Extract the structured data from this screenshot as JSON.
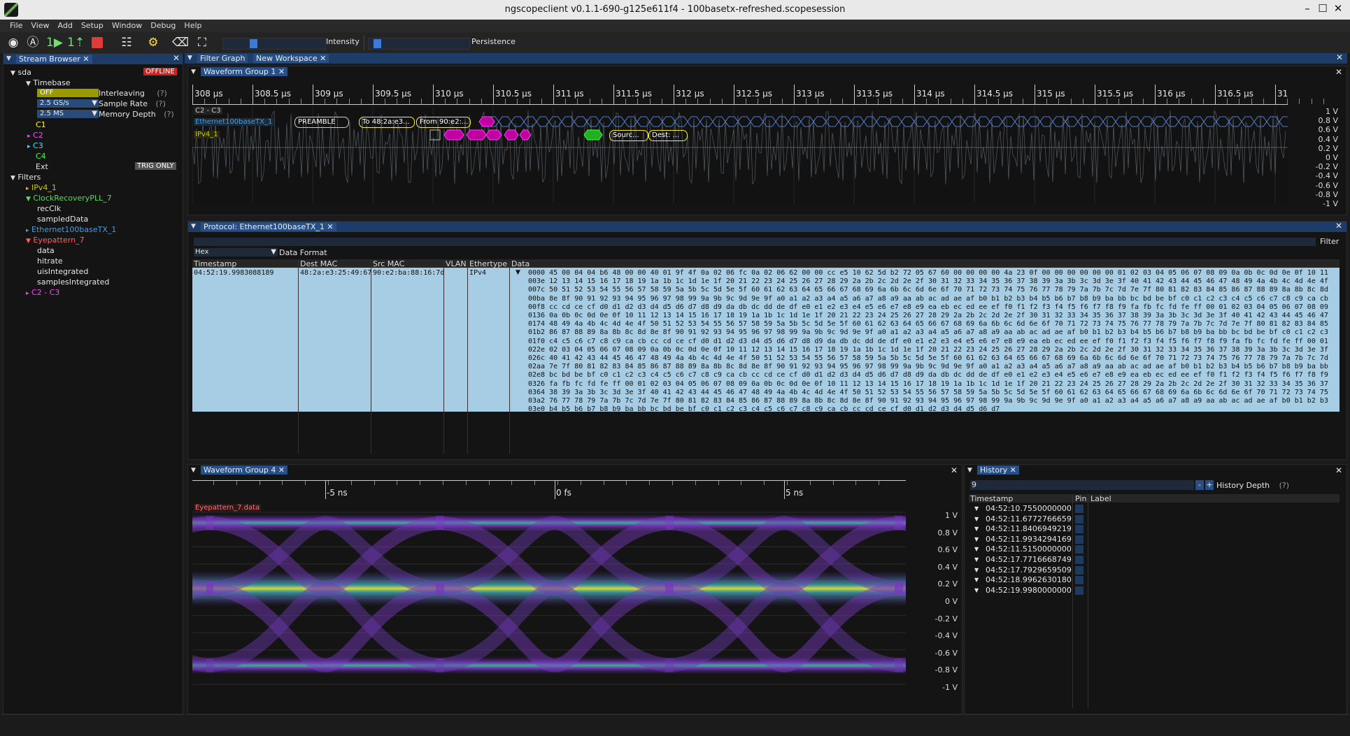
{
  "window": {
    "title": "ngscopeclient v0.1.1-690-g125e611f4 - 100basetx-refreshed.scopesession"
  },
  "menu": [
    "File",
    "View",
    "Add",
    "Setup",
    "Window",
    "Debug",
    "Help"
  ],
  "toolbar": {
    "intensity_label": "Intensity",
    "persistence_label": "Persistence",
    "intensity_level": 0.28,
    "persistence_level": 0.05
  },
  "stream_browser": {
    "tab_label": "Stream Browser",
    "instrument": "sda",
    "status": "OFFLINE",
    "timebase_label": "Timebase",
    "interleaving_value": "OFF",
    "interleaving_label": "Interleaving",
    "sample_rate_value": "2.5 GS/s",
    "sample_rate_label": "Sample Rate",
    "memory_depth_value": "2.5 MS",
    "memory_depth_label": "Memory Depth",
    "help": "(?)",
    "channels": [
      "C1",
      "C2",
      "C3",
      "C4",
      "Ext"
    ],
    "trig_only": "TRIG ONLY",
    "filters_label": "Filters",
    "filters": [
      {
        "name": "IPv4_1",
        "children": []
      },
      {
        "name": "ClockRecoveryPLL_7",
        "children": [
          "recClk",
          "sampledData"
        ]
      },
      {
        "name": "Ethernet100baseTX_1",
        "children": []
      },
      {
        "name": "Eyepattern_7",
        "children": [
          "data",
          "hitrate",
          "uisIntegrated",
          "samplesIntegrated"
        ]
      },
      {
        "name": "C2 - C3",
        "children": []
      }
    ]
  },
  "top_tabs": {
    "filter_graph": "Filter Graph",
    "workspace": "New Workspace"
  },
  "wfg1": {
    "tab": "Waveform Group 1",
    "time_labels": [
      "308 µs",
      "308.5 µs",
      "309 µs",
      "309.5 µs",
      "310 µs",
      "310.5 µs",
      "311 µs",
      "311.5 µs",
      "312 µs",
      "312.5 µs",
      "313 µs",
      "313.5 µs",
      "314 µs",
      "314.5 µs",
      "315 µs",
      "315.5 µs",
      "316 µs",
      "316.5 µs",
      "31"
    ],
    "volt_labels": [
      "1 V",
      "0.8 V",
      "0.6 V",
      "0.4 V",
      "0.2 V",
      "0 V",
      "-0.2 V",
      "-0.4 V",
      "-0.6 V",
      "-0.8 V",
      "-1 V"
    ],
    "trace_label": "C2 - C3",
    "eth_label": "Ethernet100baseTX_1",
    "ipv4_label": "IPv4_1",
    "eth_boxes": [
      "PREAMBLE",
      "To 48:2a:e3...",
      "From 90:e2:..."
    ],
    "ipv4_boxes": [
      "Sourc...",
      "Dest: ..."
    ]
  },
  "protocol": {
    "tab": "Protocol: Ethernet100baseTX_1",
    "filter_label": "Filter",
    "format_value": "Hex",
    "format_label": "Data Format",
    "columns": [
      "Timestamp",
      "Dest MAC",
      "Src MAC",
      "VLAN",
      "Ethertype",
      "Data"
    ],
    "row": {
      "timestamp": "04:52:19.9983088189",
      "dest": "48:2a:e3:25:49:67",
      "src": "90:e2:ba:88:16:7d",
      "vlan": "",
      "ethertype": "IPv4"
    },
    "hex_lines": [
      "0000 45 00 04 04 b6 48 00 00 40 01 9f 4f 0a 02 06 fc 0a 02 06 62 00 00 cc e5 10 62 5d b2 72 05 67 60 00 00 00 00 4a 23 0f 00 00 00 00 00 00 01 02 03 04 05 06 07 08 09 0a 0b 0c 0d 0e 0f 10 11",
      "003e 12 13 14 15 16 17 18 19 1a 1b 1c 1d 1e 1f 20 21 22 23 24 25 26 27 28 29 2a 2b 2c 2d 2e 2f 30 31 32 33 34 35 36 37 38 39 3a 3b 3c 3d 3e 3f 40 41 42 43 44 45 46 47 48 49 4a 4b 4c 4d 4e 4f",
      "007c 50 51 52 53 54 55 56 57 58 59 5a 5b 5c 5d 5e 5f 60 61 62 63 64 65 66 67 68 69 6a 6b 6c 6d 6e 6f 70 71 72 73 74 75 76 77 78 79 7a 7b 7c 7d 7e 7f 80 81 82 83 84 85 86 87 88 89 8a 8b 8c 8d",
      "00ba 8e 8f 90 91 92 93 94 95 96 97 98 99 9a 9b 9c 9d 9e 9f a0 a1 a2 a3 a4 a5 a6 a7 a8 a9 aa ab ac ad ae af b0 b1 b2 b3 b4 b5 b6 b7 b8 b9 ba bb bc bd be bf c0 c1 c2 c3 c4 c5 c6 c7 c8 c9 ca cb",
      "00f8 cc cd ce cf d0 d1 d2 d3 d4 d5 d6 d7 d8 d9 da db dc dd de df e0 e1 e2 e3 e4 e5 e6 e7 e8 e9 ea eb ec ed ee ef f0 f1 f2 f3 f4 f5 f6 f7 f8 f9 fa fb fc fd fe ff 00 01 02 03 04 05 06 07 08 09",
      "0136 0a 0b 0c 0d 0e 0f 10 11 12 13 14 15 16 17 18 19 1a 1b 1c 1d 1e 1f 20 21 22 23 24 25 26 27 28 29 2a 2b 2c 2d 2e 2f 30 31 32 33 34 35 36 37 38 39 3a 3b 3c 3d 3e 3f 40 41 42 43 44 45 46 47",
      "0174 48 49 4a 4b 4c 4d 4e 4f 50 51 52 53 54 55 56 57 58 59 5a 5b 5c 5d 5e 5f 60 61 62 63 64 65 66 67 68 69 6a 6b 6c 6d 6e 6f 70 71 72 73 74 75 76 77 78 79 7a 7b 7c 7d 7e 7f 80 81 82 83 84 85",
      "01b2 86 87 88 89 8a 8b 8c 8d 8e 8f 90 91 92 93 94 95 96 97 98 99 9a 9b 9c 9d 9e 9f a0 a1 a2 a3 a4 a5 a6 a7 a8 a9 aa ab ac ad ae af b0 b1 b2 b3 b4 b5 b6 b7 b8 b9 ba bb bc bd be bf c0 c1 c2 c3",
      "01f0 c4 c5 c6 c7 c8 c9 ca cb cc cd ce cf d0 d1 d2 d3 d4 d5 d6 d7 d8 d9 da db dc dd de df e0 e1 e2 e3 e4 e5 e6 e7 e8 e9 ea eb ec ed ee ef f0 f1 f2 f3 f4 f5 f6 f7 f8 f9 fa fb fc fd fe ff 00 01",
      "022e 02 03 04 05 06 07 08 09 0a 0b 0c 0d 0e 0f 10 11 12 13 14 15 16 17 18 19 1a 1b 1c 1d 1e 1f 20 21 22 23 24 25 26 27 28 29 2a 2b 2c 2d 2e 2f 30 31 32 33 34 35 36 37 38 39 3a 3b 3c 3d 3e 3f",
      "026c 40 41 42 43 44 45 46 47 48 49 4a 4b 4c 4d 4e 4f 50 51 52 53 54 55 56 57 58 59 5a 5b 5c 5d 5e 5f 60 61 62 63 64 65 66 67 68 69 6a 6b 6c 6d 6e 6f 70 71 72 73 74 75 76 77 78 79 7a 7b 7c 7d",
      "02aa 7e 7f 80 81 82 83 84 85 86 87 88 89 8a 8b 8c 8d 8e 8f 90 91 92 93 94 95 96 97 98 99 9a 9b 9c 9d 9e 9f a0 a1 a2 a3 a4 a5 a6 a7 a8 a9 aa ab ac ad ae af b0 b1 b2 b3 b4 b5 b6 b7 b8 b9 ba bb",
      "02e8 bc bd be bf c0 c1 c2 c3 c4 c5 c6 c7 c8 c9 ca cb cc cd ce cf d0 d1 d2 d3 d4 d5 d6 d7 d8 d9 da db dc dd de df e0 e1 e2 e3 e4 e5 e6 e7 e8 e9 ea eb ec ed ee ef f0 f1 f2 f3 f4 f5 f6 f7 f8 f9",
      "0326 fa fb fc fd fe ff 00 01 02 03 04 05 06 07 08 09 0a 0b 0c 0d 0e 0f 10 11 12 13 14 15 16 17 18 19 1a 1b 1c 1d 1e 1f 20 21 22 23 24 25 26 27 28 29 2a 2b 2c 2d 2e 2f 30 31 32 33 34 35 36 37",
      "0364 38 39 3a 3b 3c 3d 3e 3f 40 41 42 43 44 45 46 47 48 49 4a 4b 4c 4d 4e 4f 50 51 52 53 54 55 56 57 58 59 5a 5b 5c 5d 5e 5f 60 61 62 63 64 65 66 67 68 69 6a 6b 6c 6d 6e 6f 70 71 72 73 74 75",
      "03a2 76 77 78 79 7a 7b 7c 7d 7e 7f 80 81 82 83 84 85 86 87 88 89 8a 8b 8c 8d 8e 8f 90 91 92 93 94 95 96 97 98 99 9a 9b 9c 9d 9e 9f a0 a1 a2 a3 a4 a5 a6 a7 a8 a9 aa ab ac ad ae af b0 b1 b2 b3",
      "03e0 b4 b5 b6 b7 b8 b9 ba bb bc bd be bf c0 c1 c2 c3 c4 c5 c6 c7 c8 c9 ca cb cc cd ce cf d0 d1 d2 d3 d4 d5 d6 d7"
    ]
  },
  "wfg4": {
    "tab": "Waveform Group 4",
    "time_labels": [
      "-5 ns",
      "0 fs",
      "5 ns"
    ],
    "trace_label": "Eyepattern_7.data",
    "volt_labels": [
      "1 V",
      "0.8 V",
      "0.6 V",
      "0.4 V",
      "0.2 V",
      "0 V",
      "-0.2 V",
      "-0.4 V",
      "-0.6 V",
      "-0.8 V",
      "-1 V"
    ]
  },
  "history": {
    "tab": "History",
    "depth_value": "9",
    "depth_label": "History Depth",
    "help": "(?)",
    "minus": "-",
    "plus": "+",
    "columns": [
      "Timestamp",
      "Pin",
      "Label"
    ],
    "rows": [
      "04:52:10.7550000000",
      "04:52:11.6772766659",
      "04:52:11.8406949219",
      "04:52:11.9934294169",
      "04:52:11.5150000000",
      "04:52:17.7716668749",
      "04:52:17.7929659509",
      "04:52:18.9962630180",
      "04:52:19.9980000000"
    ]
  },
  "colors": {
    "accent": "#284f85",
    "c1": "#ffff00",
    "c2": "#ff40ff",
    "c3": "#40e0ff",
    "c4": "#40ff40",
    "eth": "#4f9bd9",
    "ipv4": "#c8c800",
    "offline": "#e03030",
    "selected_row": "#a6cde3"
  }
}
